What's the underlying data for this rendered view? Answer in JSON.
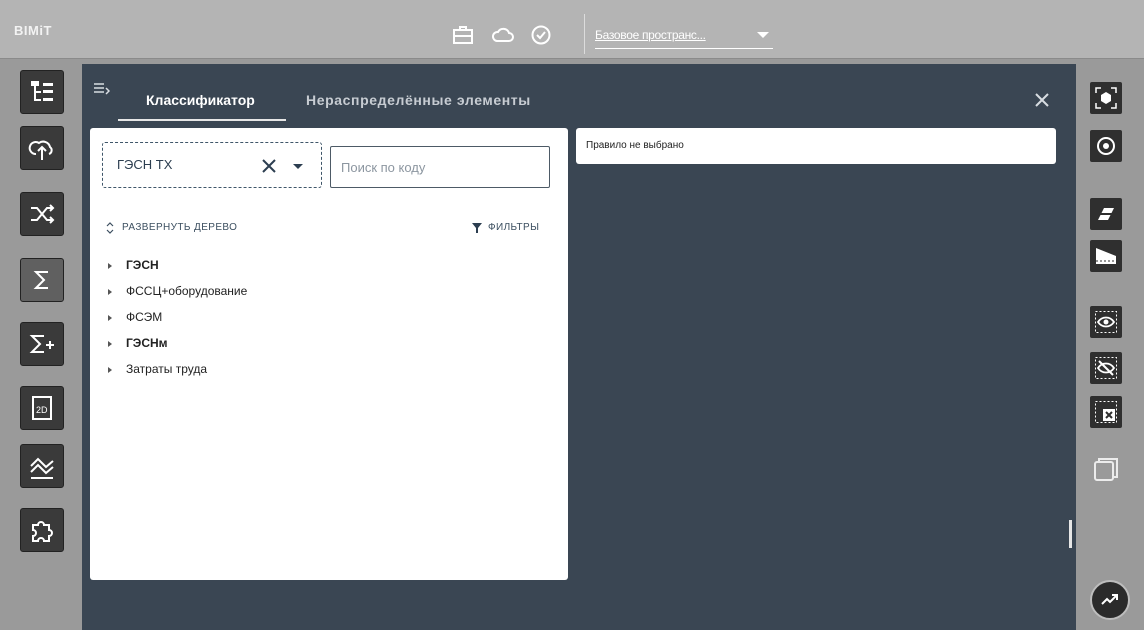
{
  "app": {
    "logo": "BIMiT"
  },
  "header": {
    "icons": [
      "briefcase-icon",
      "cloud-icon",
      "check-circle-icon"
    ],
    "workspace_label": "Базовое пространс..."
  },
  "left_toolbar": {
    "items": [
      "tree-structure-icon",
      "cloud-upload-icon",
      "shuffle-icon",
      "sigma-icon",
      "sigma-plus-icon",
      "2d-view-icon",
      "chart-lines-icon",
      "puzzle-icon"
    ],
    "active": "sigma-icon"
  },
  "panel": {
    "tabs": [
      {
        "label": "Классификатор",
        "active": true
      },
      {
        "label": "Нераспределённые элементы",
        "active": false
      }
    ]
  },
  "classifier": {
    "selected": "ГЭСН ТХ",
    "search_placeholder": "Поиск по коду",
    "expand_label": "РАЗВЕРНУТЬ ДЕРЕВО",
    "filters_label": "ФИЛЬТРЫ",
    "tree": [
      {
        "label": "ГЭСН",
        "bold": true
      },
      {
        "label": "ФССЦ+оборудование",
        "bold": false
      },
      {
        "label": "ФСЭМ",
        "bold": false
      },
      {
        "label": "ГЭСНм",
        "bold": true
      },
      {
        "label": "Затраты труда",
        "bold": false
      }
    ]
  },
  "rule": {
    "text": "Правило не выбрано"
  },
  "right_toolbar": {
    "items": [
      "focus-object-icon",
      "target-icon",
      "section-plane-icon",
      "section-box-icon",
      "show-icon",
      "hide-icon",
      "isolate-close-icon",
      "ghost-icon"
    ]
  },
  "colors": {
    "panel": "#3a4653",
    "topbar": "#b4b4b4",
    "sidebar": "#9a9a9a",
    "accent": "#2c3e50"
  }
}
